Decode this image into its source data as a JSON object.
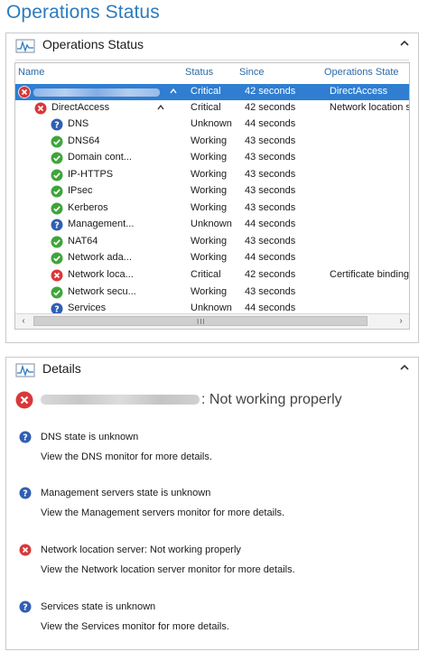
{
  "page_title": "Operations Status",
  "ops_panel": {
    "title": "Operations Status",
    "columns": {
      "name": "Name",
      "status": "Status",
      "since": "Since",
      "operations_state": "Operations State"
    },
    "selected_row": {
      "status": "Critical",
      "since": "42 seconds",
      "state": "DirectAccess"
    },
    "group_row": {
      "name": "DirectAccess",
      "status": "Critical",
      "since": "42 seconds",
      "state": "Network location s"
    },
    "rows": [
      {
        "name": "DNS",
        "icon": "question-icon",
        "status": "Unknown",
        "since": "44 seconds",
        "state": ""
      },
      {
        "name": "DNS64",
        "icon": "check-icon",
        "status": "Working",
        "since": "43 seconds",
        "state": ""
      },
      {
        "name": "Domain cont...",
        "icon": "check-icon",
        "status": "Working",
        "since": "43 seconds",
        "state": ""
      },
      {
        "name": "IP-HTTPS",
        "icon": "check-icon",
        "status": "Working",
        "since": "43 seconds",
        "state": ""
      },
      {
        "name": "IPsec",
        "icon": "check-icon",
        "status": "Working",
        "since": "43 seconds",
        "state": ""
      },
      {
        "name": "Kerberos",
        "icon": "check-icon",
        "status": "Working",
        "since": "43 seconds",
        "state": ""
      },
      {
        "name": "Management...",
        "icon": "question-icon",
        "status": "Unknown",
        "since": "44 seconds",
        "state": ""
      },
      {
        "name": "NAT64",
        "icon": "check-icon",
        "status": "Working",
        "since": "43 seconds",
        "state": ""
      },
      {
        "name": "Network ada...",
        "icon": "check-icon",
        "status": "Working",
        "since": "44 seconds",
        "state": ""
      },
      {
        "name": "Network loca...",
        "icon": "error-icon",
        "status": "Critical",
        "since": "42 seconds",
        "state": "Certificate binding"
      },
      {
        "name": "Network secu...",
        "icon": "check-icon",
        "status": "Working",
        "since": "43 seconds",
        "state": ""
      },
      {
        "name": "Services",
        "icon": "question-icon",
        "status": "Unknown",
        "since": "44 seconds",
        "state": ""
      }
    ],
    "scroll_grip": "III"
  },
  "details_panel": {
    "title": "Details",
    "headline_suffix": ": Not working properly",
    "items": [
      {
        "icon": "question-icon",
        "title": "DNS state is unknown",
        "desc": "View the DNS monitor for more details."
      },
      {
        "icon": "question-icon",
        "title": "Management servers state is unknown",
        "desc": "View the Management servers monitor for more details."
      },
      {
        "icon": "error-icon",
        "title": "Network location server: Not working properly",
        "desc": "View the Network location server monitor for more details."
      },
      {
        "icon": "question-icon",
        "title": "Services state is unknown",
        "desc": "View the Services monitor for more details."
      }
    ]
  },
  "colors": {
    "accent": "#2b7bc0",
    "selected": "#2f7ed1",
    "error": "#d9383a",
    "ok": "#3ea53a",
    "unknown": "#2f5fb3"
  }
}
